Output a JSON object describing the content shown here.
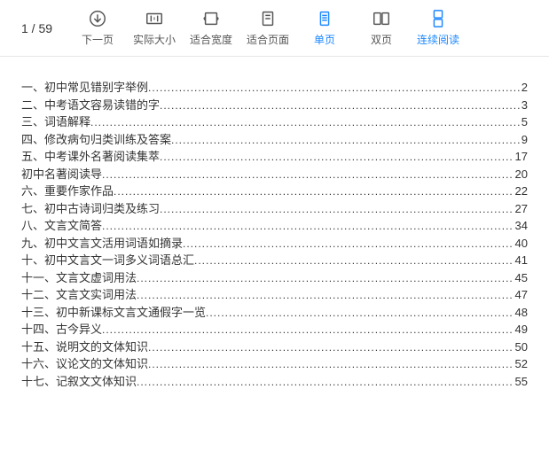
{
  "pager": {
    "current": 1,
    "total": 59,
    "text": "1 / 59"
  },
  "toolbar": {
    "next": "下一页",
    "actual": "实际大小",
    "fitWidth": "适合宽度",
    "fitPage": "适合页面",
    "single": "单页",
    "double": "双页",
    "continuous": "连续阅读"
  },
  "toc": [
    {
      "title": "一、初中常见错别字举例",
      "page": 2
    },
    {
      "title": "二、中考语文容易读错的字",
      "page": 3
    },
    {
      "title": "三、词语解释",
      "page": 5
    },
    {
      "title": "四、修改病句归类训练及答案",
      "page": 9
    },
    {
      "title": "五、中考课外名著阅读集萃",
      "page": 17
    },
    {
      "title": "初中名著阅读导",
      "page": 20
    },
    {
      "title": "六、重要作家作品",
      "page": 22
    },
    {
      "title": "七、初中古诗词归类及练习",
      "page": 27
    },
    {
      "title": "八、文言文简答",
      "page": 34
    },
    {
      "title": "九、初中文言文活用词语如摘录",
      "page": 40
    },
    {
      "title": "十、初中文言文一词多义词语总汇",
      "page": 41
    },
    {
      "title": "十一、文言文虚词用法",
      "page": 45
    },
    {
      "title": "十二、文言文实词用法",
      "page": 47
    },
    {
      "title": "十三、初中新课标文言文通假字一览",
      "page": 48
    },
    {
      "title": "十四、古今异义",
      "page": 49
    },
    {
      "title": "十五、说明文的文体知识",
      "page": 50
    },
    {
      "title": "十六、议论文的文体知识",
      "page": 52
    },
    {
      "title": "十七、记叙文文体知识",
      "page": 55
    }
  ]
}
